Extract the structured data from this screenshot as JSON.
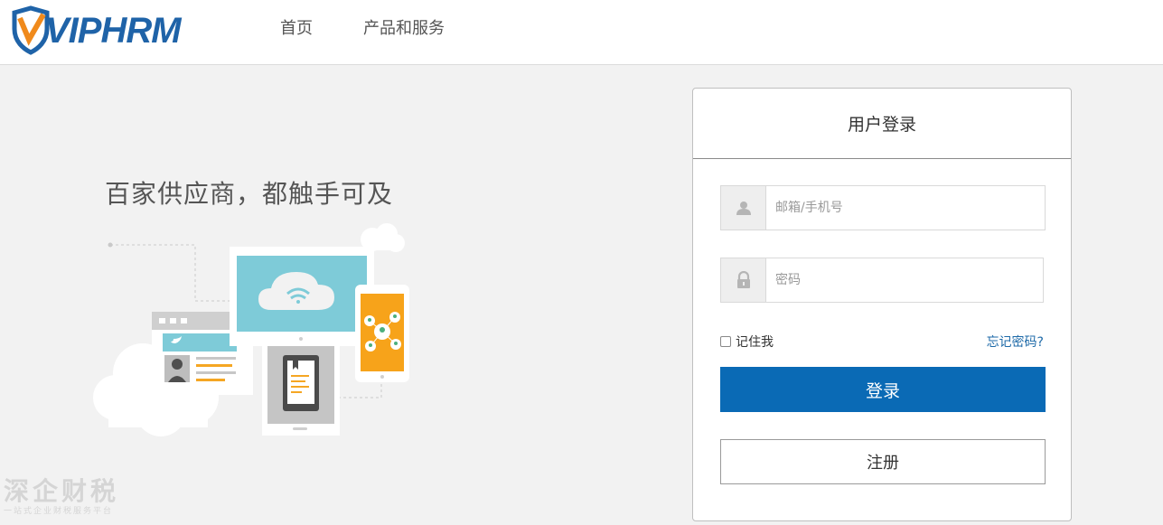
{
  "header": {
    "logo_text": "VIPHRM",
    "nav": [
      {
        "label": "首页"
      },
      {
        "label": "产品和服务"
      }
    ]
  },
  "hero": {
    "tagline": "百家供应商，都触手可及"
  },
  "watermark": {
    "title": "深企财税",
    "subtitle": "一站式企业财税服务平台"
  },
  "login": {
    "title": "用户登录",
    "username": {
      "placeholder": "邮箱/手机号",
      "value": "",
      "icon": "user-icon"
    },
    "password": {
      "placeholder": "密码",
      "value": "",
      "icon": "lock-icon"
    },
    "remember_label": "记住我",
    "remember_checked": false,
    "forgot_label": "忘记密码?",
    "login_label": "登录",
    "register_label": "注册"
  },
  "colors": {
    "brand": "#1f63a8",
    "logo_accent": "#f08a1c",
    "login_button": "#0a6ab5",
    "page_bg": "#f2f2f2"
  }
}
